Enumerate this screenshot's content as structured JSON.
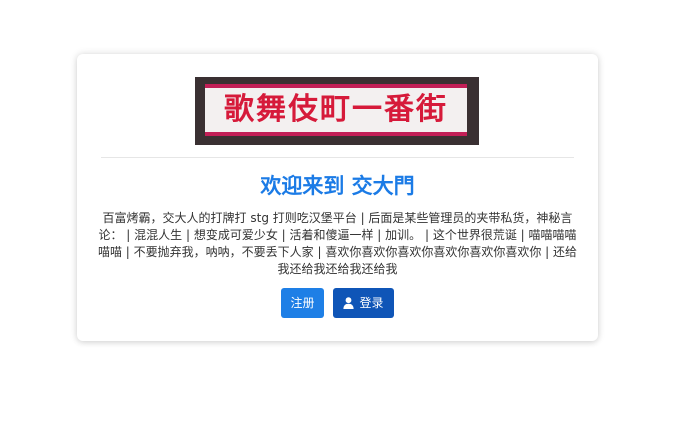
{
  "banner": {
    "text": "歌舞伎町一番街"
  },
  "header": {
    "title": "欢迎来到 交大門"
  },
  "main": {
    "description": "百富烤霸，交大人的打牌打 stg 打则吃汉堡平台 | 后面是某些管理员的夹带私货，神秘言论： | 混混人生 | 想变成可爱少女 | 活着和傻逼一样 | 加训。 | 这个世界很荒诞 | 喵喵喵喵喵喵 | 不要抛弃我，呐呐，不要丢下人家 | 喜欢你喜欢你喜欢你喜欢你喜欢你喜欢你 | 还给我还给我还给我还给我"
  },
  "actions": {
    "register_label": "注册",
    "login_label": "登录",
    "login_icon": "user-icon"
  },
  "colors": {
    "title": "#1b7be6",
    "register_button": "#1e7fe6",
    "login_button": "#0f55b7",
    "banner_text": "#d61a3a"
  }
}
